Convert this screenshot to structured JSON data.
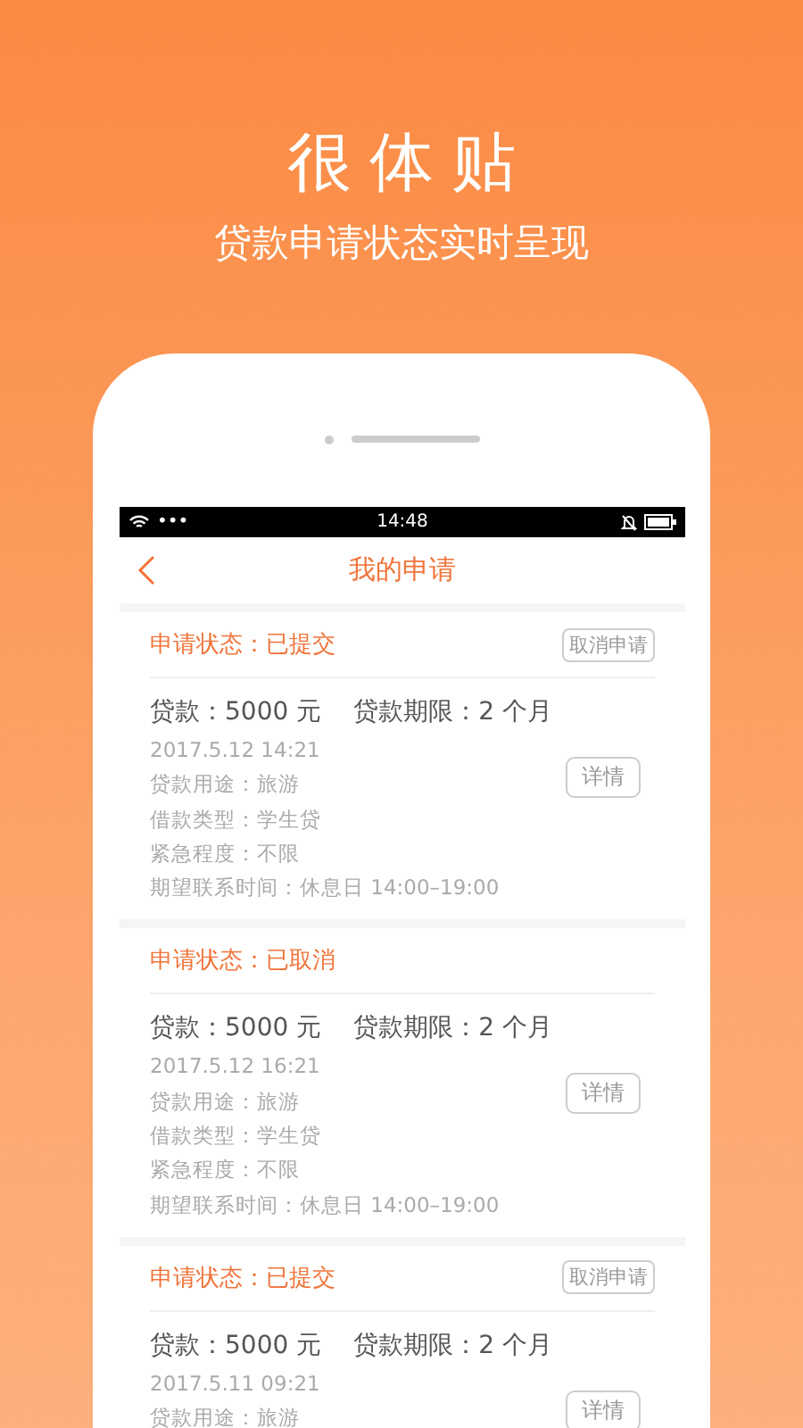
{
  "banner": {
    "title": "很体贴",
    "subtitle": "贷款申请状态实时呈现"
  },
  "status_bar": {
    "time": "14:48",
    "dots": "•••"
  },
  "nav": {
    "title": "我的申请"
  },
  "applications": [
    {
      "status": "申请状态：已提交",
      "cancel_button": "取消申请",
      "loan": "贷款：5000 元",
      "term": "贷款期限：2 个月",
      "date": "2017.5.12 14:21",
      "details": [
        "贷款用途：旅游",
        "借款类型：学生贷",
        "紧急程度：不限",
        "期望联系时间：休息日 14:00–19:00"
      ],
      "detail_button": "详情"
    },
    {
      "status": "申请状态：已取消",
      "loan": "贷款：5000 元",
      "term": "贷款期限：2 个月",
      "date": "2017.5.12 16:21",
      "details": [
        "贷款用途：旅游",
        "借款类型：学生贷",
        "紧急程度：不限",
        "期望联系时间：休息日 14:00–19:00"
      ],
      "detail_button": "详情"
    },
    {
      "status": "申请状态：已提交",
      "cancel_button": "取消申请",
      "loan": "贷款：5000 元",
      "term": "贷款期限：2 个月",
      "date": "2017.5.11 09:21",
      "details": [
        "贷款用途：旅游"
      ],
      "detail_button": "详情"
    }
  ]
}
